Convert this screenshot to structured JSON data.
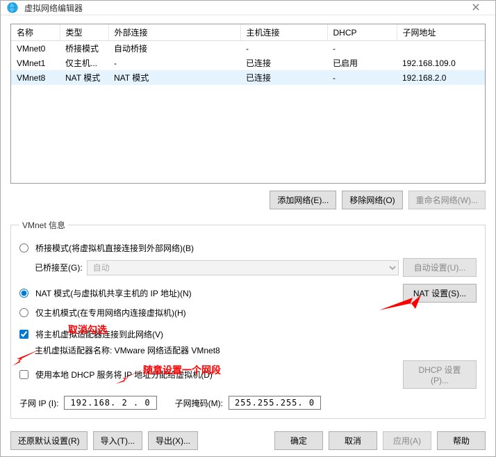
{
  "window": {
    "title": "虚拟网络编辑器"
  },
  "table": {
    "headers": {
      "name": "名称",
      "type": "类型",
      "ext": "外部连接",
      "host": "主机连接",
      "dhcp": "DHCP",
      "subnet": "子网地址"
    },
    "rows": [
      {
        "name": "VMnet0",
        "type": "桥接模式",
        "ext": "自动桥接",
        "host": "-",
        "dhcp": "-",
        "subnet": ""
      },
      {
        "name": "VMnet1",
        "type": "仅主机...",
        "ext": "-",
        "host": "已连接",
        "dhcp": "已启用",
        "subnet": "192.168.109.0"
      },
      {
        "name": "VMnet8",
        "type": "NAT 模式",
        "ext": "NAT 模式",
        "host": "已连接",
        "dhcp": "-",
        "subnet": "192.168.2.0"
      }
    ]
  },
  "netButtons": {
    "add": "添加网络(E)...",
    "remove": "移除网络(O)",
    "rename": "重命名网络(W)..."
  },
  "fieldset": {
    "legend": "VMnet 信息",
    "bridgedLabel": "桥接模式(将虚拟机直接连接到外部网络)(B)",
    "bridgedToLabel": "已桥接至(G):",
    "bridgedToValue": "自动",
    "autoSet": "自动设置(U)...",
    "natLabel": "NAT 模式(与虚拟机共享主机的 IP 地址)(N)",
    "natSet": "NAT 设置(S)...",
    "hostOnlyLabel": "仅主机模式(在专用网络内连接虚拟机)(H)",
    "connectHostLabel": "将主机虚拟适配器连接到此网络(V)",
    "hostAdapterName": "主机虚拟适配器名称: VMware 网络适配器 VMnet8",
    "useDhcpLabel": "使用本地 DHCP 服务将 IP 地址分配给虚拟机(D)",
    "dhcpSet": "DHCP 设置(P)...",
    "subnetIpLabel": "子网 IP (I):",
    "subnetIp": "192.168. 2 . 0",
    "subnetMaskLabel": "子网掩码(M):",
    "subnetMask": "255.255.255. 0"
  },
  "annotations": {
    "cancel": "取消勾选",
    "segment": "随意设置一个网段"
  },
  "bottom": {
    "restore": "还原默认设置(R)",
    "import": "导入(T)...",
    "export": "导出(X)...",
    "ok": "确定",
    "cancel": "取消",
    "apply": "应用(A)",
    "help": "帮助"
  }
}
